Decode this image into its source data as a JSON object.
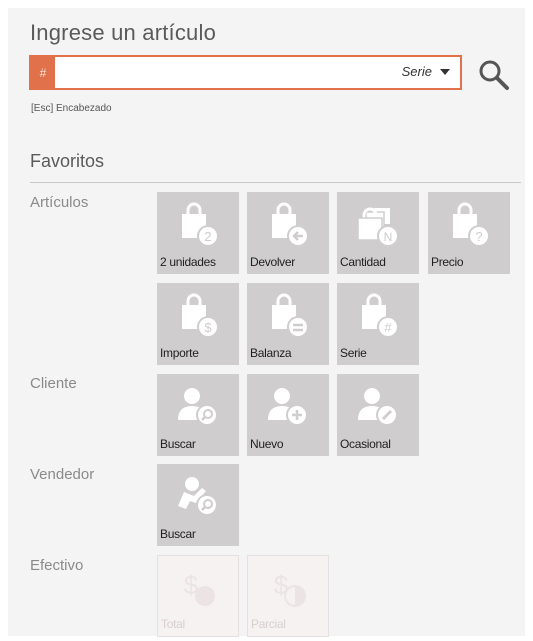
{
  "header": {
    "title": "Ingrese un artículo"
  },
  "search": {
    "prefix": "#",
    "value": "",
    "mode_selected": "Serie"
  },
  "hint": "[Esc]  Encabezado",
  "favorites": {
    "title": "Favoritos",
    "groups": [
      {
        "label": "Artículos",
        "tiles": [
          {
            "label": "2 unidades",
            "icon": "bag-2-icon"
          },
          {
            "label": "Devolver",
            "icon": "bag-return-icon"
          },
          {
            "label": "Cantidad",
            "icon": "bags-n-icon"
          },
          {
            "label": "Precio",
            "icon": "bag-question-icon"
          },
          {
            "label": "Importe",
            "icon": "bag-dollar-icon"
          },
          {
            "label": "Balanza",
            "icon": "bag-scale-icon"
          },
          {
            "label": "Serie",
            "icon": "bag-hash-icon"
          }
        ]
      },
      {
        "label": "Cliente",
        "tiles": [
          {
            "label": "Buscar",
            "icon": "user-search-icon"
          },
          {
            "label": "Nuevo",
            "icon": "user-add-icon"
          },
          {
            "label": "Ocasional",
            "icon": "user-edit-icon"
          }
        ]
      },
      {
        "label": "Vendedor",
        "tiles": [
          {
            "label": "Buscar",
            "icon": "seller-search-icon"
          }
        ]
      },
      {
        "label": "Efectivo",
        "tiles": [
          {
            "label": "Total",
            "icon": "cash-total-icon",
            "disabled": true
          },
          {
            "label": "Parcial",
            "icon": "cash-partial-icon",
            "disabled": true
          }
        ]
      }
    ]
  },
  "colors": {
    "accent": "#e0714a",
    "tile": "#cfcdcd",
    "tile_disabled": "#f6f2f2"
  }
}
